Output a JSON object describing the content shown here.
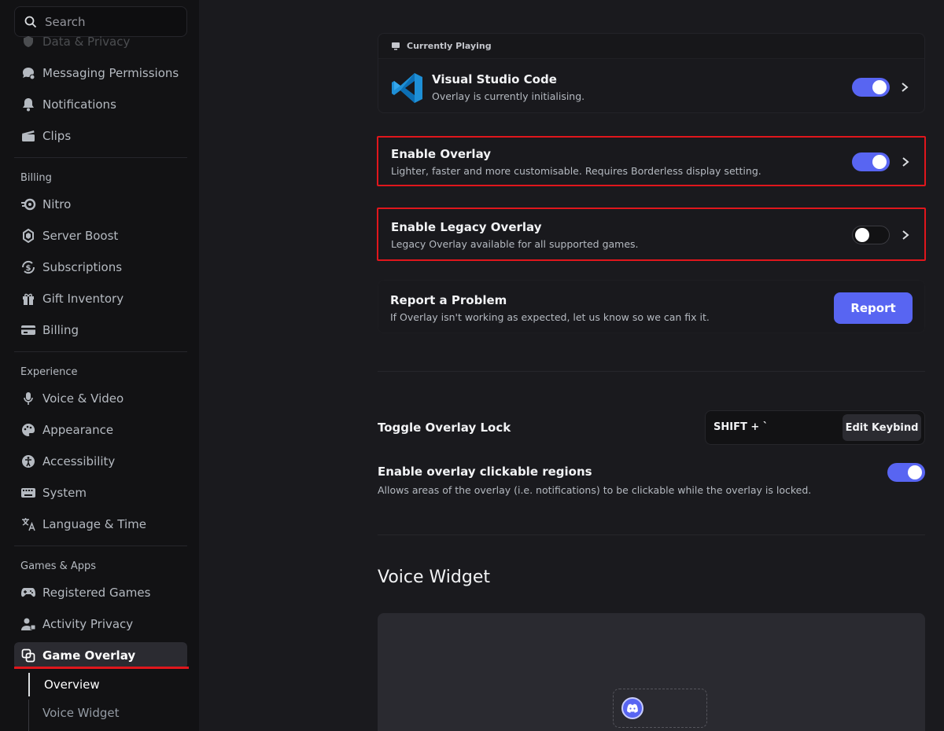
{
  "search": {
    "placeholder": "Search"
  },
  "sidebar": {
    "partial_item": "Data & Privacy",
    "items_top": [
      {
        "label": "Messaging Permissions",
        "icon": "messaging-permissions-icon"
      },
      {
        "label": "Notifications",
        "icon": "bell-icon"
      },
      {
        "label": "Clips",
        "icon": "clapperboard-icon"
      }
    ],
    "billing_label": "Billing",
    "billing_items": [
      {
        "label": "Nitro",
        "icon": "nitro-icon"
      },
      {
        "label": "Server Boost",
        "icon": "boost-gem-icon"
      },
      {
        "label": "Subscriptions",
        "icon": "subscriptions-icon"
      },
      {
        "label": "Gift Inventory",
        "icon": "gift-icon"
      },
      {
        "label": "Billing",
        "icon": "credit-card-icon"
      }
    ],
    "experience_label": "Experience",
    "experience_items": [
      {
        "label": "Voice & Video",
        "icon": "microphone-icon"
      },
      {
        "label": "Appearance",
        "icon": "palette-icon"
      },
      {
        "label": "Accessibility",
        "icon": "accessibility-icon"
      },
      {
        "label": "System",
        "icon": "keyboard-icon"
      },
      {
        "label": "Language & Time",
        "icon": "translate-icon"
      }
    ],
    "games_label": "Games & Apps",
    "games_items": [
      {
        "label": "Registered Games",
        "icon": "gamepad-icon"
      },
      {
        "label": "Activity Privacy",
        "icon": "activity-privacy-icon"
      },
      {
        "label": "Game Overlay",
        "icon": "overlay-icon",
        "active": true
      }
    ],
    "sub_items": [
      "Overview",
      "Voice Widget"
    ]
  },
  "currently_playing": {
    "header": "Currently Playing",
    "app_name": "Visual Studio Code",
    "status": "Overlay is currently initialising.",
    "toggle_on": true
  },
  "enable_overlay": {
    "title": "Enable Overlay",
    "desc": "Lighter, faster and more customisable. Requires Borderless display setting.",
    "toggle_on": true
  },
  "legacy_overlay": {
    "title": "Enable Legacy Overlay",
    "desc": "Legacy Overlay available for all supported games.",
    "toggle_on": false
  },
  "report": {
    "title": "Report a Problem",
    "desc": "If Overlay isn't working as expected, let us know so we can fix it.",
    "button": "Report"
  },
  "overlay_lock": {
    "title": "Toggle Overlay Lock",
    "keybind": "SHIFT + `",
    "edit_button": "Edit Keybind"
  },
  "clickable_regions": {
    "title": "Enable overlay clickable regions",
    "desc": "Allows areas of the overlay (i.e. notifications) to be clickable while the overlay is locked.",
    "toggle_on": true
  },
  "voice_widget": {
    "heading": "Voice Widget"
  },
  "colors": {
    "accent": "#5865f2",
    "highlight": "#e0161c",
    "background": "#1a1a1e",
    "sidebar": "#121214"
  }
}
